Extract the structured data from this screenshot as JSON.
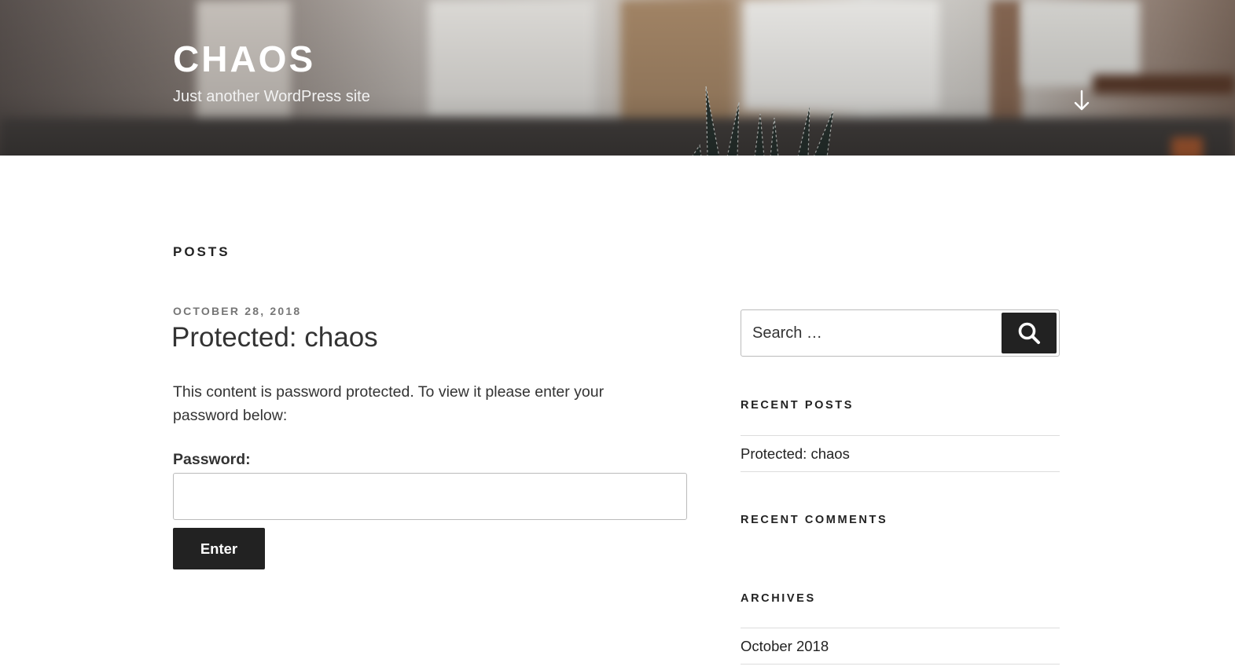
{
  "header": {
    "site_title": "CHAOS",
    "tagline": "Just another WordPress site",
    "scroll_icon": "arrow-down-icon"
  },
  "main": {
    "page_title": "POSTS",
    "post": {
      "date": "OCTOBER 28, 2018",
      "title": "Protected: chaos",
      "protected_message": "This content is password protected. To view it please enter your password below:",
      "password_label": "Password:",
      "password_value": "",
      "submit_label": "Enter"
    }
  },
  "sidebar": {
    "search": {
      "placeholder": "Search …",
      "icon": "search-icon"
    },
    "recent_posts": {
      "title": "RECENT POSTS",
      "items": [
        "Protected: chaos"
      ]
    },
    "recent_comments": {
      "title": "RECENT COMMENTS",
      "items": []
    },
    "archives": {
      "title": "ARCHIVES",
      "items": [
        "October 2018"
      ]
    }
  },
  "colors": {
    "text": "#222222",
    "muted": "#767676",
    "button_bg": "#222222",
    "border": "#bbbbbb",
    "divider": "#dddddd"
  }
}
